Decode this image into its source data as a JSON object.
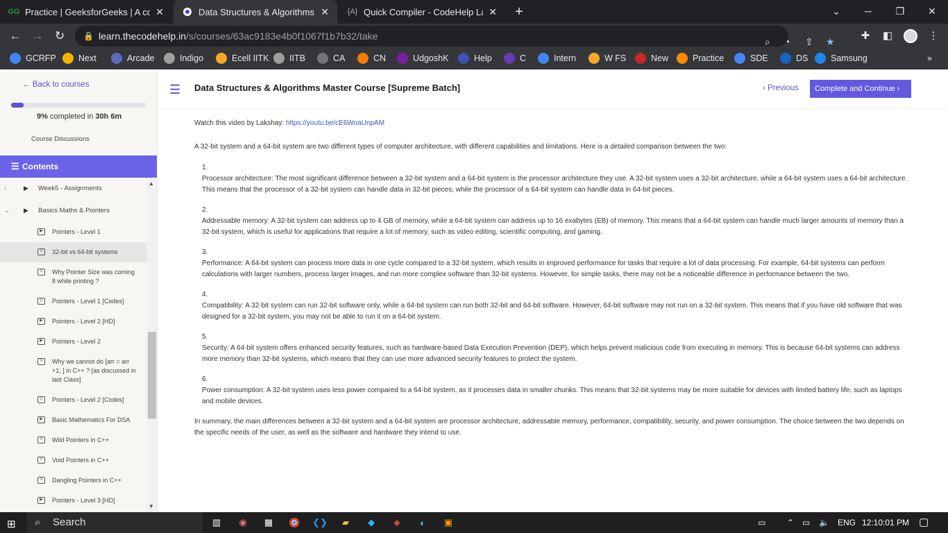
{
  "browser": {
    "tabs": [
      {
        "title": "Practice | GeeksforGeeks | A comp",
        "icon": "geeksforgeeks-icon",
        "active": false
      },
      {
        "title": "Data Structures & Algorithms Ma",
        "icon": "codehelp-icon",
        "active": true
      },
      {
        "title": "Quick Compiler - CodeHelp Labs",
        "icon": "codehelp-labs-icon",
        "active": false
      }
    ],
    "new_tab": "+",
    "window_controls": {
      "chevron": "⌄",
      "minimize": "─",
      "restore": "❐",
      "close": "✕"
    },
    "url_domain": "learn.thecodehelp.in",
    "url_path": "/s/courses/63ac9183e4b0f1067f1b7b32/take",
    "bookmarks": [
      {
        "label": "GCRFP",
        "color": "#4285f4"
      },
      {
        "label": "Next",
        "color": "#f4b400"
      },
      {
        "label": "Arcade",
        "color": "#5c6bc0"
      },
      {
        "label": "Indigo",
        "color": "#9e9e9e"
      },
      {
        "label": "Ecell IITK",
        "color": "#f9a825"
      },
      {
        "label": "IITB",
        "color": "#9e9e9e"
      },
      {
        "label": "CA",
        "color": "#757575"
      },
      {
        "label": "CN",
        "color": "#f57c00"
      },
      {
        "label": "UdgoshK",
        "color": "#7b1fa2"
      },
      {
        "label": "Help",
        "color": "#3f51b5"
      },
      {
        "label": "C",
        "color": "#673ab7"
      },
      {
        "label": "Intern",
        "color": "#4285f4"
      },
      {
        "label": "W FS",
        "color": "#f9a825"
      },
      {
        "label": "New",
        "color": "#c62828"
      },
      {
        "label": "Practice",
        "color": "#fb8c00"
      },
      {
        "label": "SDE",
        "color": "#4285f4"
      },
      {
        "label": "DS",
        "color": "#1565c0"
      },
      {
        "label": "Samsung",
        "color": "#1e88e5"
      }
    ],
    "more_bookmarks": "»"
  },
  "sidebar": {
    "back_label": "Back to courses",
    "progress_fraction": 0.09,
    "progress_pct": "9%",
    "progress_completed": "completed in",
    "progress_time": "30h 6m",
    "discussions_label": "Course Discussions",
    "contents_label": "Contents",
    "sections": [
      {
        "label": "Week5 - Assignments",
        "expanded": false
      },
      {
        "label": "Basics Maths & Pointers",
        "expanded": true
      }
    ],
    "lessons": [
      {
        "label": "Pointers - Level 1",
        "icon": "video-icon",
        "active": false
      },
      {
        "label": "32-bit vs 64-bit systems",
        "icon": "document-icon",
        "active": true
      },
      {
        "label": "Why Pointer Size was coming 8 while printing ?",
        "icon": "document-icon",
        "active": false
      },
      {
        "label": "Pointers - Level 1 [Codes]",
        "icon": "code-icon",
        "active": false
      },
      {
        "label": "Pointers - Level 2 [HD]",
        "icon": "video-icon",
        "active": false
      },
      {
        "label": "Pointers - Level 2",
        "icon": "video-icon",
        "active": false
      },
      {
        "label": "Why we cannot do [arr = arr +1; ] in C++ ? [as discussed in last Class]",
        "icon": "document-icon",
        "active": false
      },
      {
        "label": "Pointers - Level 2 [Codes]",
        "icon": "code-icon",
        "active": false
      },
      {
        "label": "Basic Mathematics For DSA",
        "icon": "video-icon",
        "active": false
      },
      {
        "label": "Wild Pointers in C++",
        "icon": "document-icon",
        "active": false
      },
      {
        "label": "Void Pointers in C++",
        "icon": "document-icon",
        "active": false
      },
      {
        "label": "Dangling Pointers in C++",
        "icon": "document-icon",
        "active": false
      },
      {
        "label": "Pointers - Level 3 [HD]",
        "icon": "video-icon",
        "active": false
      },
      {
        "label": "Pointers - Level 3",
        "icon": "video-icon",
        "active": false
      },
      {
        "label": "Pointers - Level 3 [Codes]",
        "icon": "code-icon",
        "active": false
      }
    ]
  },
  "header": {
    "title": "Data Structures & Algorithms Master Course [Supreme Batch]",
    "previous_label": "Previous",
    "continue_label": "Complete and Continue"
  },
  "content": {
    "video_prefix": "Watch this video by Lakshay: ",
    "video_link": "https://youtu.be/cE6WoaUnpAM",
    "intro": "A 32-bit system and a 64-bit system are two different types of computer architecture, with different capabilities and limitations. Here is a detailed comparison between the two:",
    "points": [
      {
        "num": "1.",
        "text": "Processor architecture: The most significant difference between a 32-bit system and a 64-bit system is the processor architecture they use. A 32-bit system uses a 32-bit architecture, while a 64-bit system uses a 64-bit architecture. This means that the processor of a 32-bit system can handle data in 32-bit pieces, while the processor of a 64-bit system can handle data in 64-bit pieces."
      },
      {
        "num": "2.",
        "text": "Addressable memory: A 32-bit system can address up to 4 GB of memory, while a 64-bit system can address up to 16 exabytes (EB) of memory. This means that a 64-bit system can handle much larger amounts of memory than a 32-bit system, which is useful for applications that require a lot of memory, such as video editing, scientific computing, and gaming."
      },
      {
        "num": "3.",
        "text": "Performance: A 64-bit system can process more data in one cycle compared to a 32-bit system, which results in improved performance for tasks that require a lot of data processing. For example, 64-bit systems can perform calculations with larger numbers, process larger images, and run more complex software than 32-bit systems. However, for simple tasks, there may not be a noticeable difference in performance between the two."
      },
      {
        "num": "4.",
        "text": "Compatibility: A 32-bit system can run 32-bit software only, while a 64-bit system can run both 32-bit and 64-bit software. However, 64-bit software may not run on a 32-bit system. This means that if you have old software that was designed for a 32-bit system, you may not be able to run it on a 64-bit system."
      },
      {
        "num": "5.",
        "text": "Security: A 64-bit system offers enhanced security features, such as hardware-based Data Execution Prevention (DEP), which helps prevent malicious code from executing in memory. This is because 64-bit systems can address more memory than 32-bit systems, which means that they can use more advanced security features to protect the system."
      },
      {
        "num": "6.",
        "text": "Power consumption: A 32-bit system uses less power compared to a 64-bit system, as it processes data in smaller chunks. This means that 32-bit systems may be more suitable for devices with limited battery life, such as laptops and mobile devices."
      }
    ],
    "summary": "In summary, the main differences between a 32-bit system and a 64-bit system are processor architecture, addressable memory, performance, compatibility, security, and power consumption. The choice between the two depends on the specific needs of the user, as well as the software and hardware they intend to use."
  },
  "taskbar": {
    "search_placeholder": "Search",
    "language": "ENG",
    "time": "12:10:01 PM"
  },
  "colors": {
    "accent": "#6259e0",
    "link": "#3d4fc6"
  }
}
